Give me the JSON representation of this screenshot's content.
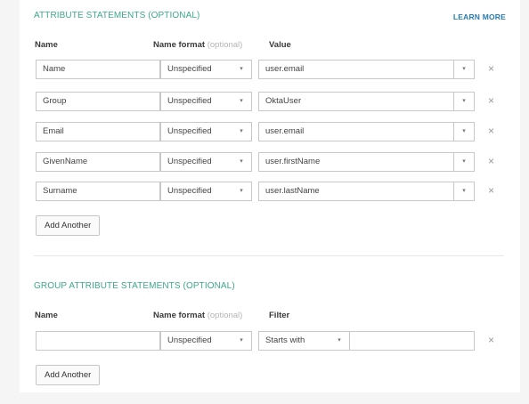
{
  "attribute_statements": {
    "title": "ATTRIBUTE STATEMENTS (OPTIONAL)",
    "learn_more": "LEARN MORE",
    "headers": {
      "name": "Name",
      "name_format": "Name format",
      "optional": "(optional)",
      "value": "Value"
    },
    "rows": [
      {
        "name": "Name",
        "format": "Unspecified",
        "value": "user.email"
      },
      {
        "name": "Group",
        "format": "Unspecified",
        "value": "OktaUser"
      },
      {
        "name": "Email",
        "format": "Unspecified",
        "value": "user.email"
      },
      {
        "name": "GivenName",
        "format": "Unspecified",
        "value": "user.firstName"
      },
      {
        "name": "Surname",
        "format": "Unspecified",
        "value": "user.lastName"
      }
    ],
    "add_another": "Add Another"
  },
  "group_attribute_statements": {
    "title": "GROUP ATTRIBUTE STATEMENTS (OPTIONAL)",
    "headers": {
      "name": "Name",
      "name_format": "Name format",
      "optional": "(optional)",
      "filter": "Filter"
    },
    "row": {
      "name": "",
      "format": "Unspecified",
      "filter_type": "Starts with",
      "filter_value": ""
    },
    "add_another": "Add Another"
  },
  "icons": {
    "caret": "▾",
    "remove": "×"
  }
}
